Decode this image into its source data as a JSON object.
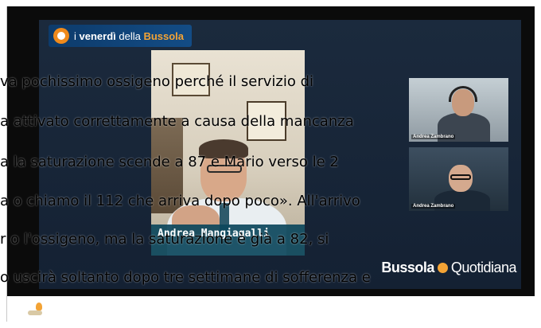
{
  "video": {
    "brand_left": {
      "prefix": "i ",
      "bold": "venerdì",
      "mid": " della ",
      "accent": "Bussola"
    },
    "speaker_name": "Andrea Mangiagalli",
    "participants": [
      {
        "name": "Andrea Zambrano"
      },
      {
        "name": "Andrea Zambrano"
      }
    ],
    "brand_right": {
      "bold": "Bussola",
      "light": "Quotidiana"
    }
  },
  "article_lines": [
    "va pochissimo ossigeno perché il servizio di",
    "a attivato correttamente a causa della mancanza",
    "a la saturazione scende a 87 e Mario verso le 2",
    "a o chiamo il 112 che arriva dopo poco». All'arrivo",
    "r o l'ossigeno, ma la saturazione è già a 82, si",
    "o uscirà soltanto dopo tre settimane di sofferenza e"
  ],
  "colors": {
    "brand_orange": "#f3a335",
    "lower_third": "#0c465c",
    "brand_blue": "#0d3b6b"
  }
}
